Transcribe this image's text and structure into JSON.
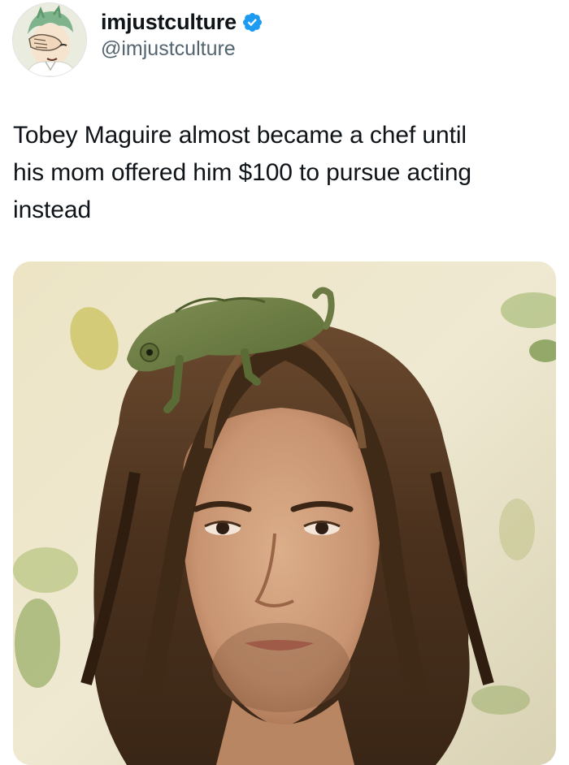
{
  "author": {
    "display_name": "imjustculture",
    "handle": "@imjustculture",
    "verified": true,
    "avatar_icon": "anime-character-facepalm-avatar"
  },
  "tweet": {
    "text": "Tobey Maguire almost became a chef until\nhis mom offered him $100 to pursue acting\ninstead"
  },
  "media": {
    "icon": "photo-portrait-with-chameleon"
  },
  "colors": {
    "text_primary": "#0f1419",
    "text_secondary": "#536471",
    "verified_blue": "#1d9bf0",
    "background": "#ffffff"
  }
}
